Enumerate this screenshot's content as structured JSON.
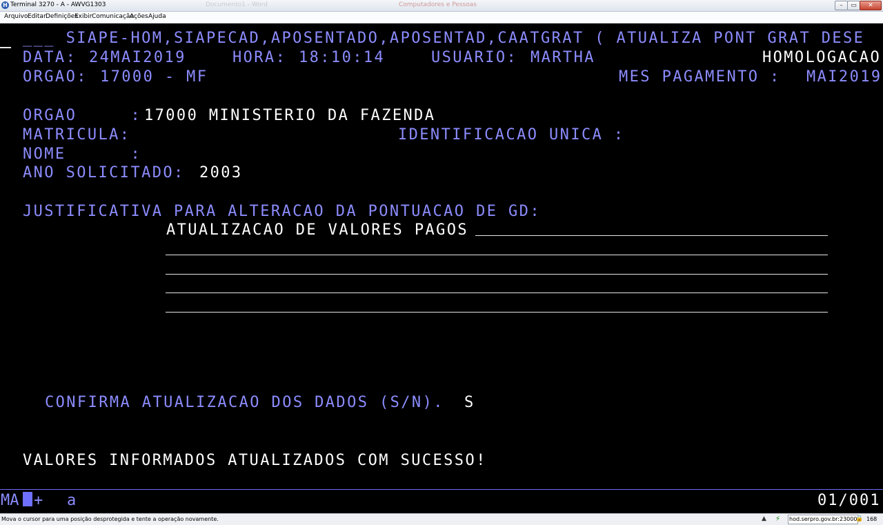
{
  "window": {
    "title": "Terminal 3270 - A - AWVG1303",
    "ghost_tab_1": "Documento1 - Word",
    "ghost_tab_2": "Computadores e Pessoas",
    "icon": "H",
    "minimize": "–",
    "maximize": "▭",
    "close": "✕"
  },
  "menu": [
    "Arquivo",
    "Editar",
    "Definições",
    "Exibir",
    "Comunicação",
    "Ações",
    "Ajuda"
  ],
  "screen": {
    "header_line": "___ SIAPE-HOM,SIAPECAD,APOSENTADO,APOSENTAD,CAATGRAT ( ATUALIZA PONT GRAT DESE",
    "data_label": "DATA:",
    "data_value": "24MAI2019",
    "hora_label": "HORA:",
    "hora_value": "18:10:14",
    "usuario_label": "USUARIO:",
    "usuario_value": "MARTHA",
    "environment": "HOMOLOGACAO",
    "orgao_header_label": "ORGAO:",
    "orgao_header_value": "17000 - MF",
    "mes_pagamento_label": "MES PAGAMENTO :",
    "mes_pagamento_value": "MAI2019",
    "orgao_label": "ORGAO     :",
    "orgao_value": "17000 MINISTERIO DA FAZENDA",
    "matricula_label": "MATRICULA:",
    "matricula_value": "",
    "identificacao_label": "IDENTIFICACAO UNICA :",
    "identificacao_value": "",
    "nome_label": "NOME      :",
    "nome_value": "",
    "ano_label": "ANO SOLICITADO:",
    "ano_value": "2003",
    "justificativa_label": "JUSTIFICATIVA PARA ALTERACAO DA PONTUACAO DE GD:",
    "justificativa_lines": [
      "ATUALIZACAO DE VALORES PAGOS",
      "",
      "",
      "",
      ""
    ],
    "confirma_label": "CONFIRMA ATUALIZACAO DOS DADOS (S/N).",
    "confirma_value": "S",
    "message": "VALORES INFORMADOS ATUALIZADOS COM SUCESSO!"
  },
  "oia": {
    "mode": "MA",
    "plus": "+",
    "indicator": "a",
    "cursor_pos": "01/001"
  },
  "statusbar": {
    "message": "Mova o cursor para uma posição desprotegida e tente a operação novamente.",
    "up_arrow": "▲",
    "connection_icon": "⚡",
    "host": "hod.serpro.gov.br:23000",
    "lock_icon": "🔒",
    "number": "168"
  }
}
